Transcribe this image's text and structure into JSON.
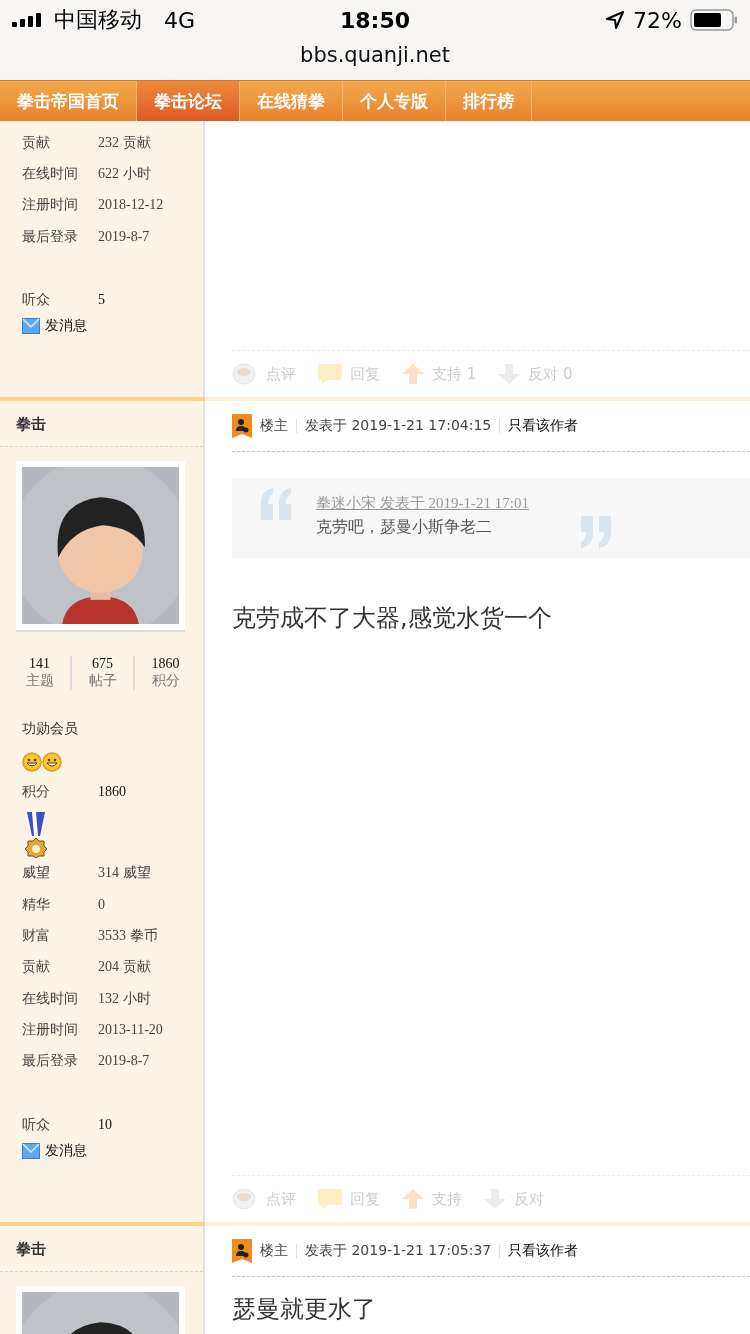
{
  "status_bar": {
    "carrier": "中国移动",
    "network": "4G",
    "time": "18:50",
    "battery": "72%"
  },
  "address_bar": {
    "url": "bbs.quanji.net"
  },
  "nav": {
    "tabs": [
      {
        "label": "拳击帝国首页",
        "selected": false
      },
      {
        "label": "拳击论坛",
        "selected": true
      },
      {
        "label": "在线猜拳",
        "selected": false
      },
      {
        "label": "个人专版",
        "selected": false
      },
      {
        "label": "排行榜",
        "selected": false
      }
    ]
  },
  "posts": [
    {
      "profile": {
        "stats": [
          {
            "label": "贡献",
            "value": "232 贡献"
          },
          {
            "label": "在线时间",
            "value": "622 小时"
          },
          {
            "label": "注册时间",
            "value": "2018-12-12"
          },
          {
            "label": "最后登录",
            "value": "2019-8-7"
          }
        ],
        "followers": {
          "label": "听众",
          "value": "5"
        },
        "message_link": "发消息"
      },
      "actions": [
        {
          "kind": "comment",
          "label": "点评"
        },
        {
          "kind": "reply",
          "label": "回复"
        },
        {
          "kind": "support",
          "label": "支持 1"
        },
        {
          "kind": "oppose",
          "label": "反对 0"
        }
      ]
    },
    {
      "author": "拳击",
      "counts": [
        {
          "value": "141",
          "label": "主题"
        },
        {
          "value": "675",
          "label": "帖子"
        },
        {
          "value": "1860",
          "label": "积分"
        }
      ],
      "profile": {
        "rank": "功勋会员",
        "score": {
          "label": "积分",
          "value": "1860"
        },
        "stats": [
          {
            "label": "威望",
            "value": "314 威望"
          },
          {
            "label": "精华",
            "value": "0"
          },
          {
            "label": "财富",
            "value": "3533 拳币"
          },
          {
            "label": "贡献",
            "value": "204 贡献"
          },
          {
            "label": "在线时间",
            "value": "132 小时"
          },
          {
            "label": "注册时间",
            "value": "2013-11-20"
          },
          {
            "label": "最后登录",
            "value": "2019-8-7"
          }
        ],
        "followers": {
          "label": "听众",
          "value": "10"
        },
        "message_link": "发消息"
      },
      "header": {
        "floor": "楼主",
        "posted": "发表于 2019-1-21 17:04:15",
        "author_only": "只看该作者"
      },
      "quote": {
        "meta": "拳迷小宋 发表于 2019-1-21 17:01",
        "text": "克劳吧，瑟曼小斯争老二"
      },
      "body": "克劳成不了大器,感觉水货一个",
      "actions": [
        {
          "kind": "comment",
          "label": "点评"
        },
        {
          "kind": "reply",
          "label": "回复"
        },
        {
          "kind": "support",
          "label": "支持"
        },
        {
          "kind": "oppose",
          "label": "反对"
        }
      ]
    },
    {
      "author": "拳击",
      "header": {
        "floor": "楼主",
        "posted": "发表于 2019-1-21 17:05:37",
        "author_only": "只看该作者"
      },
      "body": "瑟曼就更水了"
    }
  ]
}
